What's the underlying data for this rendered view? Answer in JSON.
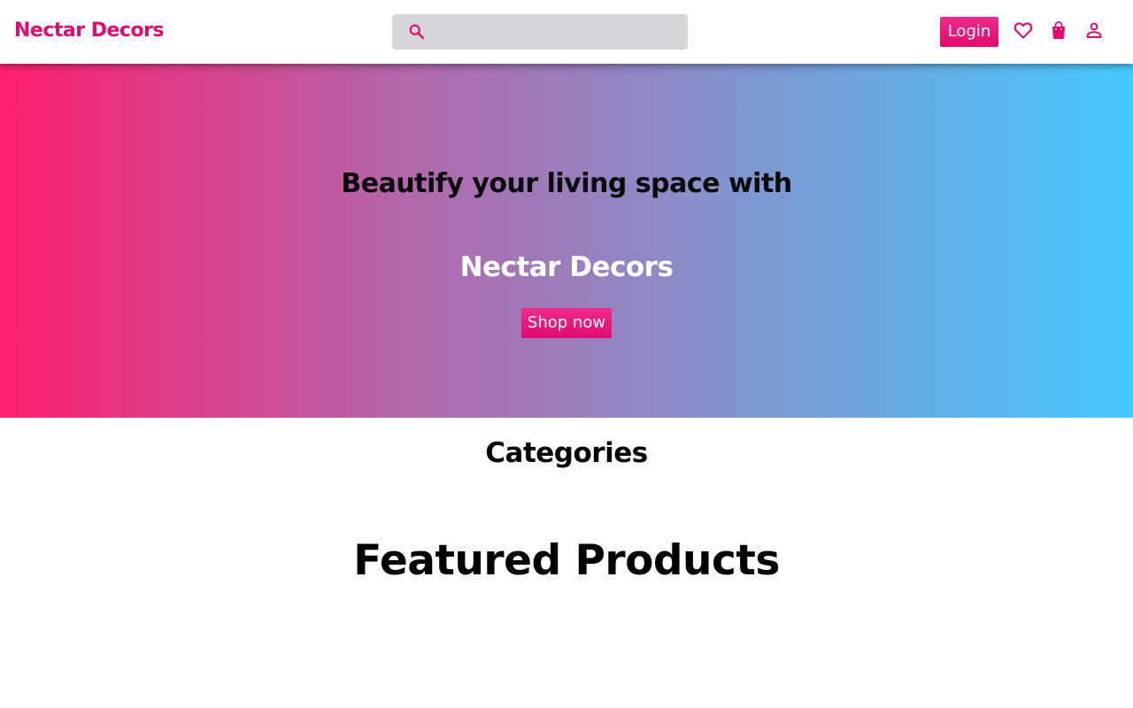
{
  "header": {
    "brand": "Nectar Decors",
    "search": {
      "placeholder": "",
      "value": ""
    },
    "login_label": "Login",
    "icons": [
      "search-icon",
      "heart-icon",
      "shopping-bag-icon",
      "user-icon"
    ]
  },
  "hero": {
    "tagline": "Beautify your living space with",
    "brand": "Nectar Decors",
    "cta_label": "Shop now"
  },
  "sections": {
    "categories_title": "Categories",
    "featured_title": "Featured Products"
  },
  "colors": {
    "accent": "#e10a6e",
    "gradient_start": "#ff1f6f",
    "gradient_end": "#45c9ff",
    "search_bg": "#d4d4d9"
  }
}
